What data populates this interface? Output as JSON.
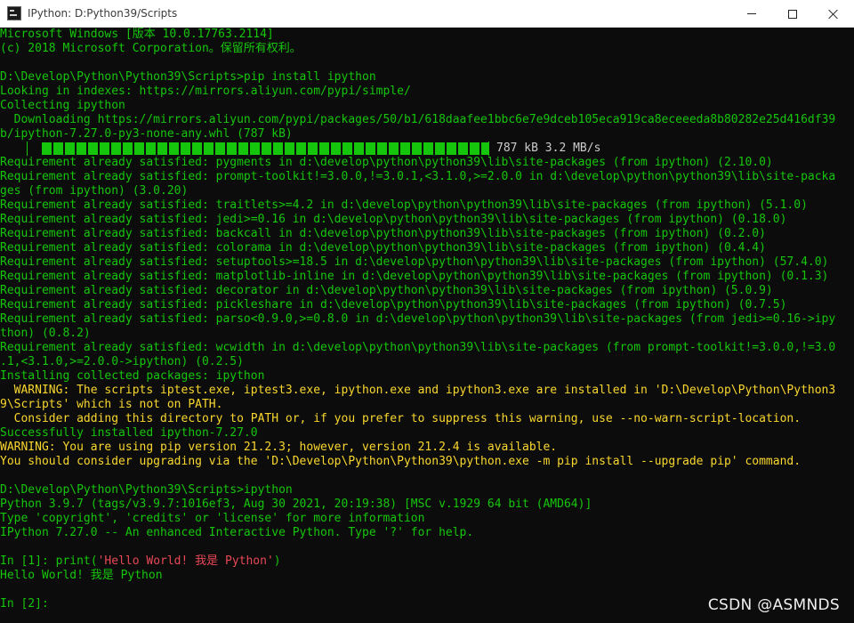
{
  "window": {
    "title": "IPython: D:Python39/Scripts"
  },
  "progress": {
    "fraction": 1.0,
    "text": "787 kB 3.2 MB/s"
  },
  "lines": [
    {
      "text": "Microsoft Windows [版本 10.0.17763.2114]",
      "color": "c-green"
    },
    {
      "text": "(c) 2018 Microsoft Corporation。保留所有权利。",
      "color": "c-green"
    },
    {
      "text": "",
      "color": ""
    },
    {
      "text": "D:\\Develop\\Python\\Python39\\Scripts>pip install ipython",
      "color": "c-green"
    },
    {
      "text": "Looking in indexes: https://mirrors.aliyun.com/pypi/simple/",
      "color": "c-green"
    },
    {
      "text": "Collecting ipython",
      "color": "c-green"
    },
    {
      "text": "  Downloading https://mirrors.aliyun.com/pypi/packages/50/b1/618daafee1bbc6e7e9dceb105eca919ca8eceeeda8b80282e25d416df39",
      "color": "c-green"
    },
    {
      "text": "b/ipython-7.27.0-py3-none-any.whl (787 kB)",
      "color": "c-green"
    },
    {
      "text": "__PROGRESS__",
      "color": ""
    },
    {
      "text": "Requirement already satisfied: pygments in d:\\develop\\python\\python39\\lib\\site-packages (from ipython) (2.10.0)",
      "color": "c-green"
    },
    {
      "text": "Requirement already satisfied: prompt-toolkit!=3.0.0,!=3.0.1,<3.1.0,>=2.0.0 in d:\\develop\\python\\python39\\lib\\site-packa",
      "color": "c-green"
    },
    {
      "text": "ges (from ipython) (3.0.20)",
      "color": "c-green"
    },
    {
      "text": "Requirement already satisfied: traitlets>=4.2 in d:\\develop\\python\\python39\\lib\\site-packages (from ipython) (5.1.0)",
      "color": "c-green"
    },
    {
      "text": "Requirement already satisfied: jedi>=0.16 in d:\\develop\\python\\python39\\lib\\site-packages (from ipython) (0.18.0)",
      "color": "c-green"
    },
    {
      "text": "Requirement already satisfied: backcall in d:\\develop\\python\\python39\\lib\\site-packages (from ipython) (0.2.0)",
      "color": "c-green"
    },
    {
      "text": "Requirement already satisfied: colorama in d:\\develop\\python\\python39\\lib\\site-packages (from ipython) (0.4.4)",
      "color": "c-green"
    },
    {
      "text": "Requirement already satisfied: setuptools>=18.5 in d:\\develop\\python\\python39\\lib\\site-packages (from ipython) (57.4.0)",
      "color": "c-green"
    },
    {
      "text": "Requirement already satisfied: matplotlib-inline in d:\\develop\\python\\python39\\lib\\site-packages (from ipython) (0.1.3)",
      "color": "c-green"
    },
    {
      "text": "Requirement already satisfied: decorator in d:\\develop\\python\\python39\\lib\\site-packages (from ipython) (5.0.9)",
      "color": "c-green"
    },
    {
      "text": "Requirement already satisfied: pickleshare in d:\\develop\\python\\python39\\lib\\site-packages (from ipython) (0.7.5)",
      "color": "c-green"
    },
    {
      "text": "Requirement already satisfied: parso<0.9.0,>=0.8.0 in d:\\develop\\python\\python39\\lib\\site-packages (from jedi>=0.16->ipy",
      "color": "c-green"
    },
    {
      "text": "thon) (0.8.2)",
      "color": "c-green"
    },
    {
      "text": "Requirement already satisfied: wcwidth in d:\\develop\\python\\python39\\lib\\site-packages (from prompt-toolkit!=3.0.0,!=3.0",
      "color": "c-green"
    },
    {
      "text": ".1,<3.1.0,>=2.0.0->ipython) (0.2.5)",
      "color": "c-green"
    },
    {
      "text": "Installing collected packages: ipython",
      "color": "c-green"
    },
    {
      "text": "  WARNING: The scripts iptest.exe, iptest3.exe, ipython.exe and ipython3.exe are installed in 'D:\\Develop\\Python\\Python3",
      "color": "c-orange"
    },
    {
      "text": "9\\Scripts' which is not on PATH.",
      "color": "c-orange"
    },
    {
      "text": "  Consider adding this directory to PATH or, if you prefer to suppress this warning, use --no-warn-script-location.",
      "color": "c-orange"
    },
    {
      "text": "Successfully installed ipython-7.27.0",
      "color": "c-green"
    },
    {
      "text": "WARNING: You are using pip version 21.2.3; however, version 21.2.4 is available.",
      "color": "c-orange"
    },
    {
      "text": "You should consider upgrading via the 'D:\\Develop\\Python\\Python39\\python.exe -m pip install --upgrade pip' command.",
      "color": "c-orange"
    },
    {
      "text": "",
      "color": ""
    },
    {
      "text": "D:\\Develop\\Python\\Python39\\Scripts>ipython",
      "color": "c-green"
    },
    {
      "text": "Python 3.9.7 (tags/v3.9.7:1016ef3, Aug 30 2021, 20:19:38) [MSC v.1929 64 bit (AMD64)]",
      "color": "c-green"
    },
    {
      "text": "Type 'copyright', 'credits' or 'license' for more information",
      "color": "c-green"
    },
    {
      "text": "IPython 7.27.0 -- An enhanced Interactive Python. Type '?' for help.",
      "color": "c-green"
    },
    {
      "text": "",
      "color": ""
    },
    {
      "text": "__INPUT1__",
      "color": ""
    },
    {
      "text": "Hello World! 我是 Python",
      "color": "c-green"
    },
    {
      "text": "",
      "color": ""
    },
    {
      "text": "__INPUT2__",
      "color": ""
    }
  ],
  "input1": {
    "prompt": "In [1]: ",
    "code_start": "print(",
    "string": "'Hello World! 我是 Python'",
    "code_end": ")"
  },
  "input2": {
    "prompt": "In [2]:"
  },
  "watermark": "CSDN @ASMNDS"
}
